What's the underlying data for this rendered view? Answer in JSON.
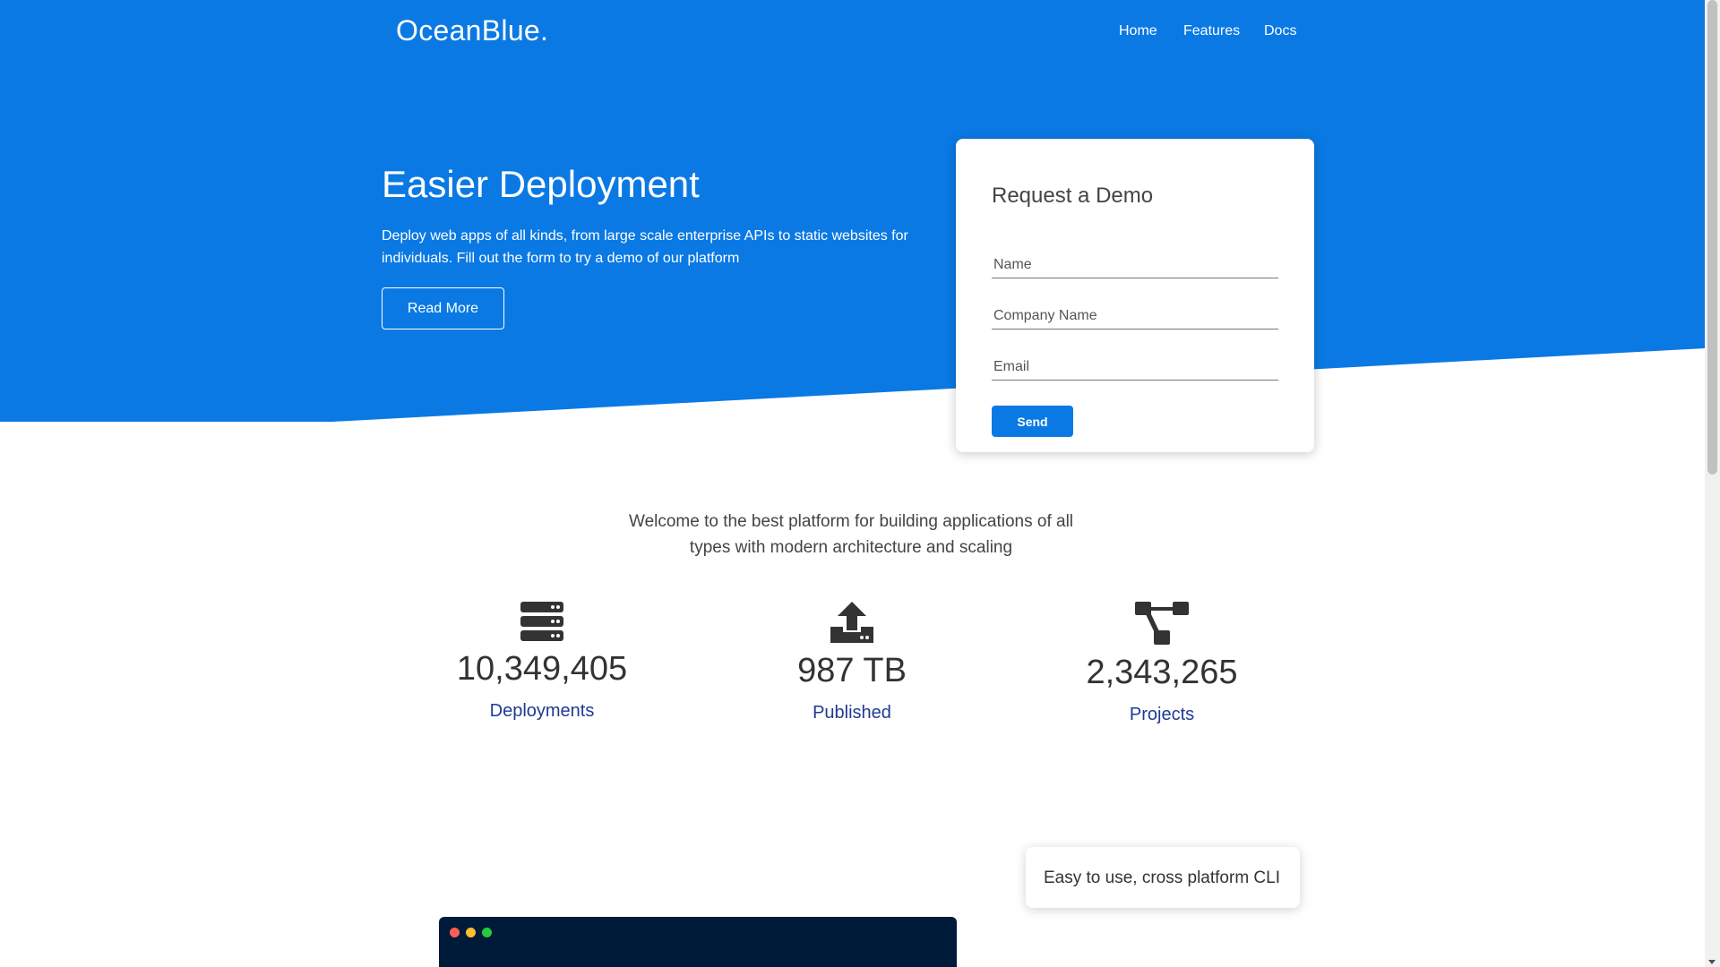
{
  "brand": {
    "name": "OceanBlue."
  },
  "nav": {
    "items": [
      "Home",
      "Features",
      "Docs"
    ]
  },
  "hero": {
    "title": "Easier Deployment",
    "text": "Deploy web apps of all kinds, from large scale enterprise APIs to static websites for individuals. Fill out the form to try a demo of our platform",
    "button_label": "Read More"
  },
  "demo_form": {
    "title": "Request a Demo",
    "name_placeholder": "Name",
    "company_placeholder": "Company Name",
    "email_placeholder": "Email",
    "name_value": "",
    "company_value": "",
    "email_value": "",
    "send_label": "Send"
  },
  "welcome": {
    "text": "Welcome to the best platform for building applications of all types with modern architecture and scaling"
  },
  "stats": [
    {
      "icon": "server-icon",
      "value": "10,349,405",
      "label": "Deployments"
    },
    {
      "icon": "upload-icon",
      "value": "987 TB",
      "label": "Published"
    },
    {
      "icon": "project-diagram-icon",
      "value": "2,343,265",
      "label": "Projects"
    }
  ],
  "features": {
    "cli_card": "Easy to use, cross platform CLI"
  },
  "colors": {
    "primary": "#0a79e4",
    "accent_text": "#1f3a93",
    "terminal_bg": "#001a3a",
    "terminal_dots": [
      "#ff5f56",
      "#ffbd2e",
      "#27c93f"
    ]
  }
}
